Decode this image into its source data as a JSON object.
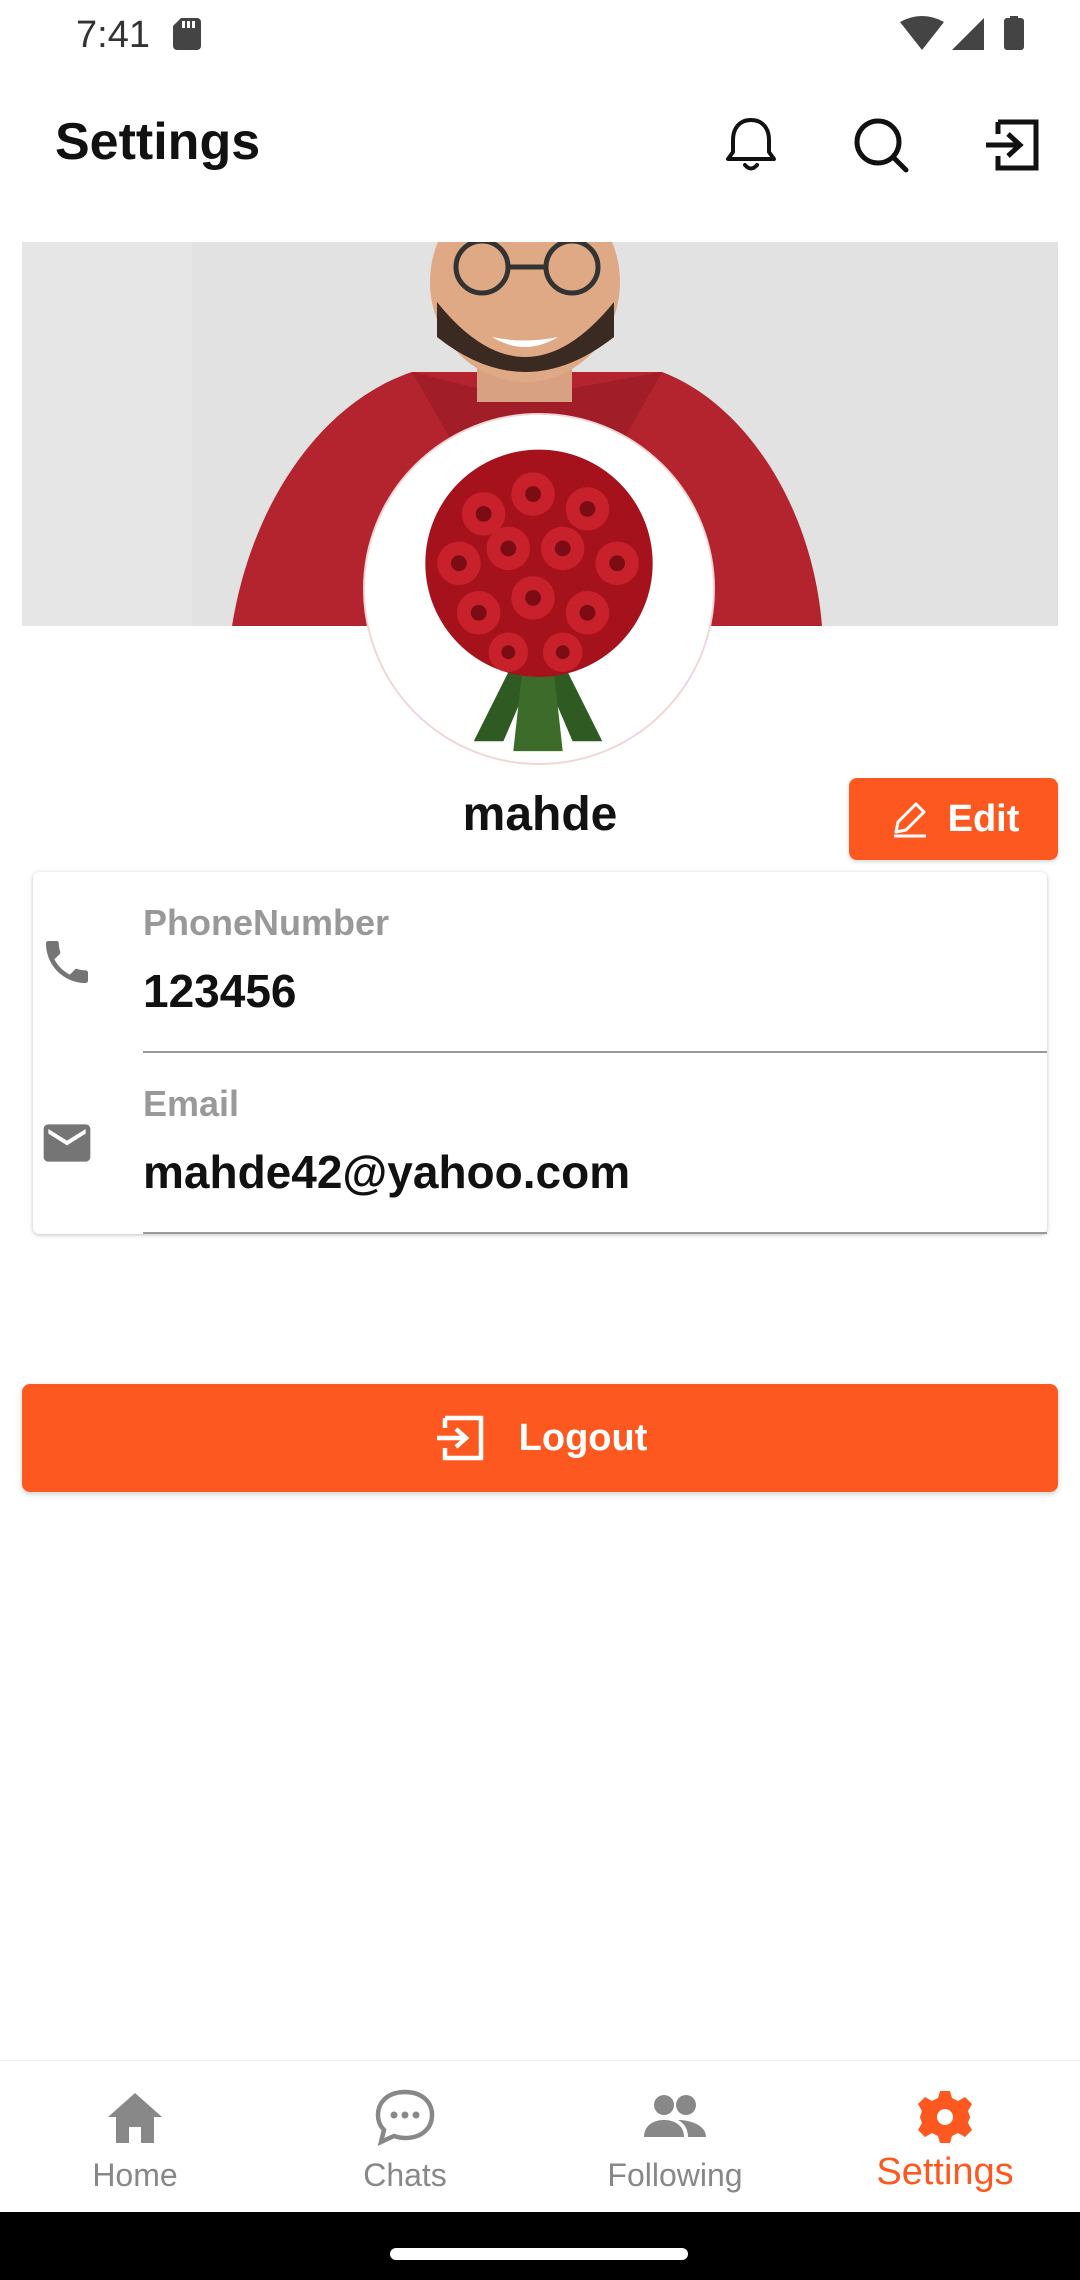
{
  "status_bar": {
    "time": "7:41"
  },
  "app_bar": {
    "title": "Settings"
  },
  "profile": {
    "username": "mahde",
    "edit_label": "Edit"
  },
  "info": {
    "phone_label": "PhoneNumber",
    "phone_value": "123456",
    "email_label": "Email",
    "email_value": "mahde42@yahoo.com"
  },
  "logout": {
    "label": "Logout"
  },
  "bottom_nav": {
    "items": [
      {
        "label": "Home",
        "icon": "home-icon"
      },
      {
        "label": "Chats",
        "icon": "chat-bubble-icon"
      },
      {
        "label": "Following",
        "icon": "people-icon"
      },
      {
        "label": "Settings",
        "icon": "gear-icon",
        "active": true
      }
    ]
  },
  "colors": {
    "accent": "#fc5820",
    "inactive": "#888888",
    "cover_bg": "#e0e0e0"
  }
}
